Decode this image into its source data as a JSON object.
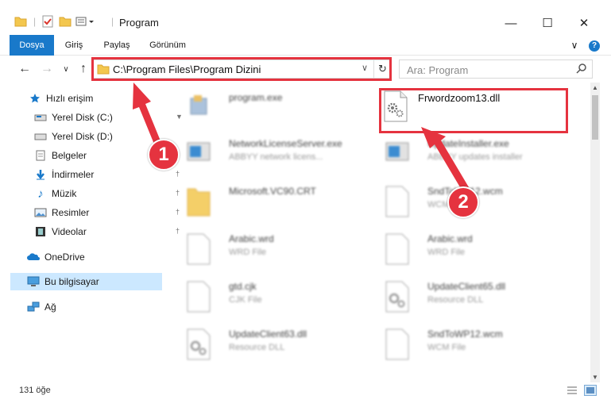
{
  "window": {
    "title": "Program",
    "minimize_icon": "minimize-icon",
    "maximize_icon": "maximize-icon",
    "close_icon": "close-icon"
  },
  "ribbon": {
    "tabs": [
      "Dosya",
      "Giriş",
      "Paylaş",
      "Görünüm"
    ]
  },
  "nav": {
    "address": "C:\\Program Files\\Program Dizini",
    "search_placeholder": "Ara: Program"
  },
  "sidebar": {
    "items": [
      {
        "label": "Hızlı erişim",
        "icon": "star-icon"
      },
      {
        "label": "Yerel Disk (C:)",
        "icon": "drive-icon"
      },
      {
        "label": "Yerel Disk (D:)",
        "icon": "drive-icon"
      },
      {
        "label": "Belgeler",
        "icon": "documents-icon"
      },
      {
        "label": "İndirmeler",
        "icon": "download-icon"
      },
      {
        "label": "Müzik",
        "icon": "music-icon"
      },
      {
        "label": "Resimler",
        "icon": "pictures-icon"
      },
      {
        "label": "Videolar",
        "icon": "video-icon"
      },
      {
        "label": "OneDrive",
        "icon": "cloud-icon"
      },
      {
        "label": "Bu bilgisayar",
        "icon": "computer-icon"
      },
      {
        "label": "Ağ",
        "icon": "network-icon"
      }
    ]
  },
  "files": [
    {
      "name": "program.exe",
      "type": ""
    },
    {
      "name": "Frwordzoom13.dll",
      "type": ""
    },
    {
      "name": "NetworkLicenseServer.exe",
      "type": "ABBYY network licens..."
    },
    {
      "name": "UpdateInstaller.exe",
      "type": "ABBYY updates installer"
    },
    {
      "name": "Microsoft.VC90.CRT",
      "type": ""
    },
    {
      "name": "SndToWP12.wcm",
      "type": "WCM File"
    },
    {
      "name": "Arabic.wrd",
      "type": "WRD File"
    },
    {
      "name": "Arabic.wrd",
      "type": "WRD File"
    },
    {
      "name": "gtd.cjk",
      "type": "CJK File"
    },
    {
      "name": "UpdateClient65.dll",
      "type": "Resource DLL"
    },
    {
      "name": "UpdateClient63.dll",
      "type": "Resource DLL"
    },
    {
      "name": "SndToWP12.wcm",
      "type": "WCM File"
    }
  ],
  "status": {
    "count": "131 öğe"
  },
  "annotations": {
    "marker1": "1",
    "marker2": "2",
    "color": "#e5333f"
  }
}
